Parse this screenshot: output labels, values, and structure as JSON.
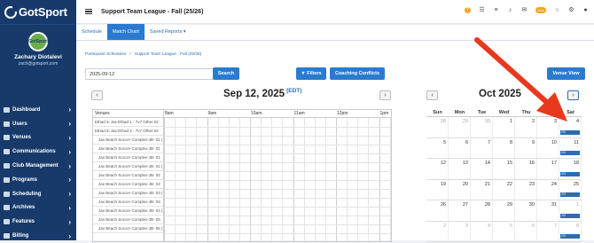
{
  "brand": {
    "name": "GotSport"
  },
  "profile": {
    "name": "Zachary Diotalevi",
    "email": "zach@gotsport.com",
    "avatar_text": "GotSport"
  },
  "sidebar": {
    "items": [
      {
        "label": "Dashboard"
      },
      {
        "label": "Users"
      },
      {
        "label": "Venues"
      },
      {
        "label": "Communications"
      },
      {
        "label": "Club Management"
      },
      {
        "label": "Programs"
      },
      {
        "label": "Scheduling"
      },
      {
        "label": "Archives"
      },
      {
        "label": "Features"
      },
      {
        "label": "Billing"
      }
    ]
  },
  "header": {
    "title": "Support Team League - Fall (25/26)",
    "badge": "New"
  },
  "tabs": [
    {
      "label": "Schedule"
    },
    {
      "label": "Match Chart"
    },
    {
      "label": "Saved Reports ▾"
    }
  ],
  "breadcrumb": {
    "item1": "Participant Schedules",
    "item2": "Support Team League - Fall (25/26)"
  },
  "toolbar": {
    "date_value": "2025-09-12",
    "search_label": "Search",
    "filters_label": "Filters",
    "coaching_label": "Coaching Conflicts",
    "venue_view_label": "Venue View"
  },
  "day_view": {
    "title": "Sep 12, 2025",
    "tz": "(EDT)",
    "venues_header": "Venues",
    "times": [
      "8am",
      "9am",
      "10am",
      "11am",
      "12pm",
      "1pm"
    ],
    "venues": [
      "Ethad in Jax-Ethad 1 - 7v7 Other 02",
      "Ethad in Jax-Ethad 2 - 7v7 Other 02",
      "Jax Beach Soccer Complex-JB- 01 (",
      "Jax Beach Soccer Complex-JB- 01",
      "Jax Beach Soccer Complex-JB- 01",
      "Jax Beach Soccer Complex-JB- 02 (",
      "Jax Beach Soccer Complex-JB- 02",
      "Jax Beach Soccer Complex-JB- 02",
      "Jax Beach Soccer Complex-JB- 03 (",
      "Jax Beach Soccer Complex-JB- 03",
      "Jax Beach Soccer Complex-JB- 04 (",
      "Jax Beach Soccer Complex-JB- 05",
      "Jax Beach Soccer Complex-JB- 06 ("
    ]
  },
  "month_view": {
    "title": "Oct 2025",
    "dows": [
      "Sun",
      "Mon",
      "Tue",
      "Wed",
      "Thu",
      "Fri",
      "Sat"
    ],
    "weeks": [
      [
        {
          "d": "28",
          "o": true
        },
        {
          "d": "29",
          "o": true
        },
        {
          "d": "30",
          "o": true
        },
        {
          "d": "1"
        },
        {
          "d": "2"
        },
        {
          "d": "3"
        },
        {
          "d": "4",
          "ev": "2/0"
        }
      ],
      [
        {
          "d": "5"
        },
        {
          "d": "6"
        },
        {
          "d": "7"
        },
        {
          "d": "8"
        },
        {
          "d": "9"
        },
        {
          "d": "10"
        },
        {
          "d": "11",
          "ev": "2/0"
        }
      ],
      [
        {
          "d": "12"
        },
        {
          "d": "13"
        },
        {
          "d": "14"
        },
        {
          "d": "15"
        },
        {
          "d": "16"
        },
        {
          "d": "17"
        },
        {
          "d": "18",
          "ev": "2/0"
        }
      ],
      [
        {
          "d": "19"
        },
        {
          "d": "20"
        },
        {
          "d": "21"
        },
        {
          "d": "22"
        },
        {
          "d": "23"
        },
        {
          "d": "24"
        },
        {
          "d": "25",
          "ev": "2/0"
        }
      ],
      [
        {
          "d": "26"
        },
        {
          "d": "27"
        },
        {
          "d": "28"
        },
        {
          "d": "29"
        },
        {
          "d": "30"
        },
        {
          "d": "31"
        },
        {
          "d": "1",
          "o": true,
          "ev": "2/0"
        }
      ],
      [
        {
          "d": "2",
          "o": true
        },
        {
          "d": "3",
          "o": true
        },
        {
          "d": "4",
          "o": true
        },
        {
          "d": "5",
          "o": true
        },
        {
          "d": "6",
          "o": true
        },
        {
          "d": "7",
          "o": true
        },
        {
          "d": "8",
          "o": true,
          "ev": "2/0"
        }
      ]
    ]
  },
  "colors": {
    "sidebar": "#173a6b",
    "accent": "#2a7bd0",
    "arrow": "#e8391e"
  }
}
